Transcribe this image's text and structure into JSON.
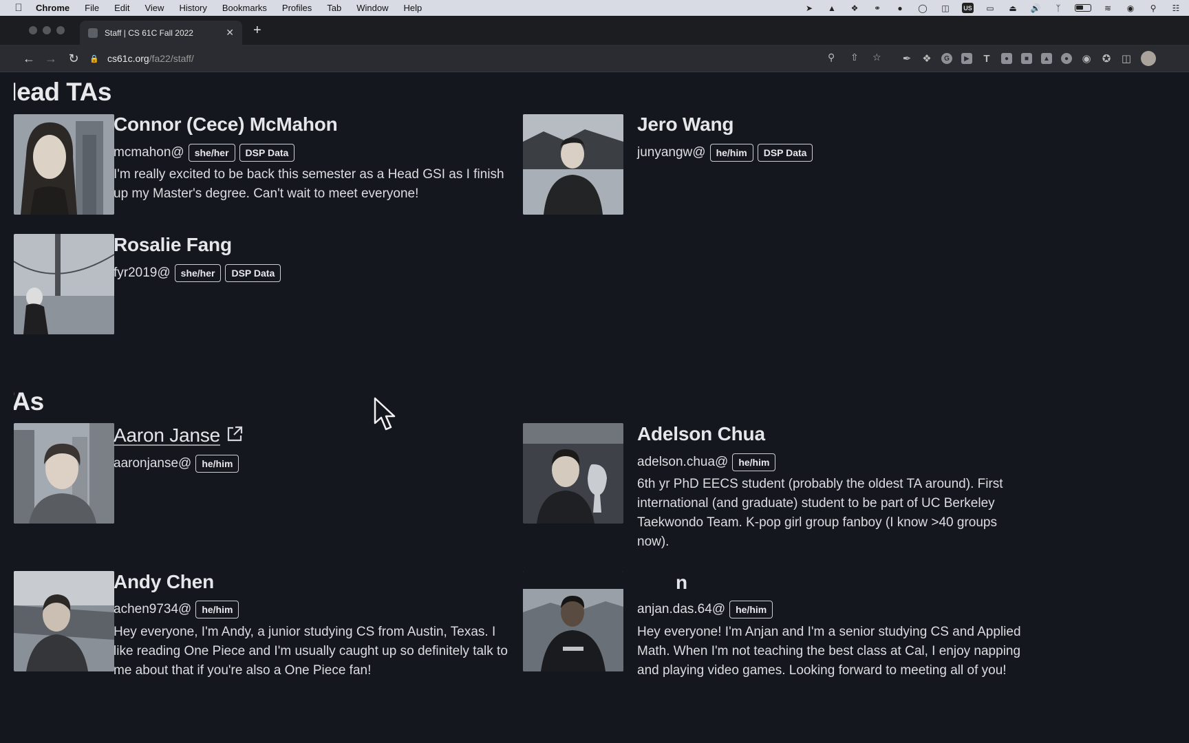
{
  "menubar": {
    "app": "Chrome",
    "items": [
      "File",
      "Edit",
      "View",
      "History",
      "Bookmarks",
      "Profiles",
      "Tab",
      "Window",
      "Help"
    ],
    "status_box_label": "US"
  },
  "tab": {
    "title": "Staff | CS 61C Fall 2022"
  },
  "toolbar": {
    "url_host": "cs61c.org",
    "url_path": "/fa22/staff/"
  },
  "sections": {
    "head_tas": {
      "title": "Head TAs"
    },
    "tas": {
      "title": "TAs"
    }
  },
  "staff": {
    "connor": {
      "name": "Connor (Cece) McMahon",
      "email": "mcmahon@",
      "pronouns": "she/her",
      "tag": "DSP Data",
      "bio_lines": [
        "I'm really excited to be back this semester as a Head GSI as I finish",
        "up my Master's degree. Can't wait to meet everyone!"
      ]
    },
    "jero": {
      "name": "Jero Wang",
      "email": "junyangw@",
      "pronouns": "he/him",
      "tag": "DSP Data"
    },
    "rosalie": {
      "name": "Rosalie Fang",
      "email": "fyr2019@",
      "pronouns": "she/her",
      "tag": "DSP Data"
    },
    "aaron": {
      "name": "Aaron Janse",
      "email": "aaronjanse@",
      "pronouns": "he/him"
    },
    "adelson": {
      "name": "Adelson Chua",
      "email": "adelson.chua@",
      "pronouns": "he/him",
      "bio_lines": [
        "6th yr PhD EECS student (probably the oldest TA around). First",
        "international (and graduate) student to be part of UC Berkeley",
        "Taekwondo Team. K-pop girl group fanboy (I know >40 groups",
        "now)."
      ]
    },
    "andy": {
      "name": "Andy Chen",
      "email": "achen9734@",
      "pronouns": "he/him",
      "bio_lines": [
        "Hey everyone, I'm Andy, a junior studying CS from Austin, Texas. I",
        "like reading One Piece and I'm usually caught up so definitely talk to",
        "me about that if you're also a One Piece fan!"
      ]
    },
    "anjan": {
      "name": "n",
      "email": "anjan.das.64@",
      "pronouns": "he/him",
      "bio_lines": [
        "Hey everyone! I'm Anjan and I'm a senior studying CS and Applied",
        "Math. When I'm not teaching the best class at Cal, I enjoy napping",
        "and playing video games. Looking forward to meeting all of you!"
      ]
    }
  }
}
